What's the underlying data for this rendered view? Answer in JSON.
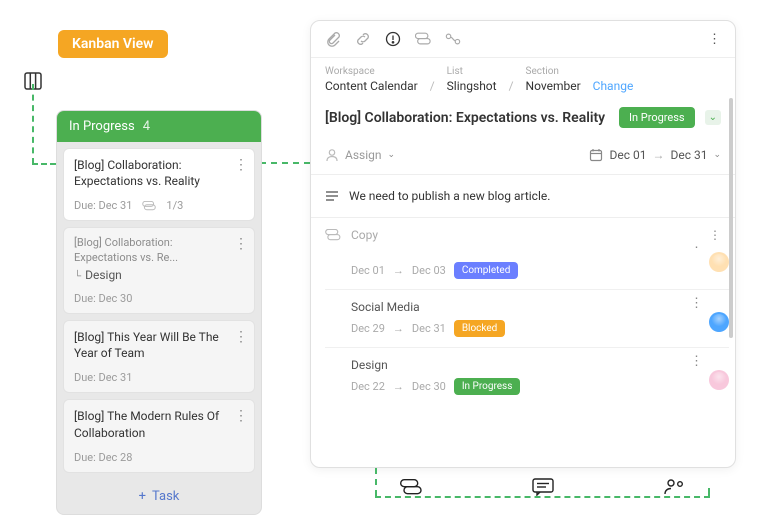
{
  "badge": "Kanban View",
  "column": {
    "title": "In Progress",
    "count": "4",
    "add_task": "Task",
    "cards": [
      {
        "title": "[Blog] Collaboration: Expectations vs. Reality",
        "due": "Due:  Dec 31",
        "comments": "1/3"
      },
      {
        "parent": "[Blog] Collaboration: Expectations vs. Re...",
        "title": "Design",
        "due": "Due:  Dec 30"
      },
      {
        "title": "[Blog] This Year Will Be The Year of Team",
        "due": "Due:  Dec 31"
      },
      {
        "title": "[Blog] The Modern Rules Of Collaboration",
        "due": "Due:  Dec 28"
      }
    ]
  },
  "panel": {
    "breadcrumb": {
      "workspace_label": "Workspace",
      "workspace": "Content Calendar",
      "list_label": "List",
      "list": "Slingshot",
      "section_label": "Section",
      "section": "November",
      "change": "Change"
    },
    "title": "[Blog] Collaboration: Expectations vs. Reality",
    "status": "In Progress",
    "assign": "Assign",
    "date_start": "Dec 01",
    "date_end": "Dec 31",
    "description": "We need to publish a new blog article.",
    "subtasks_label": "Copy",
    "subtasks": [
      {
        "name": "",
        "start": "Dec 01",
        "end": "Dec 03",
        "status": "Completed",
        "status_class": "completed",
        "avatar": "a1"
      },
      {
        "name": "Social Media",
        "start": "Dec 29",
        "end": "Dec 31",
        "status": "Blocked",
        "status_class": "blocked",
        "avatar": "a2"
      },
      {
        "name": "Design",
        "start": "Dec 22",
        "end": "Dec 30",
        "status": "In Progress",
        "status_class": "inprogress",
        "avatar": "a3"
      }
    ]
  }
}
